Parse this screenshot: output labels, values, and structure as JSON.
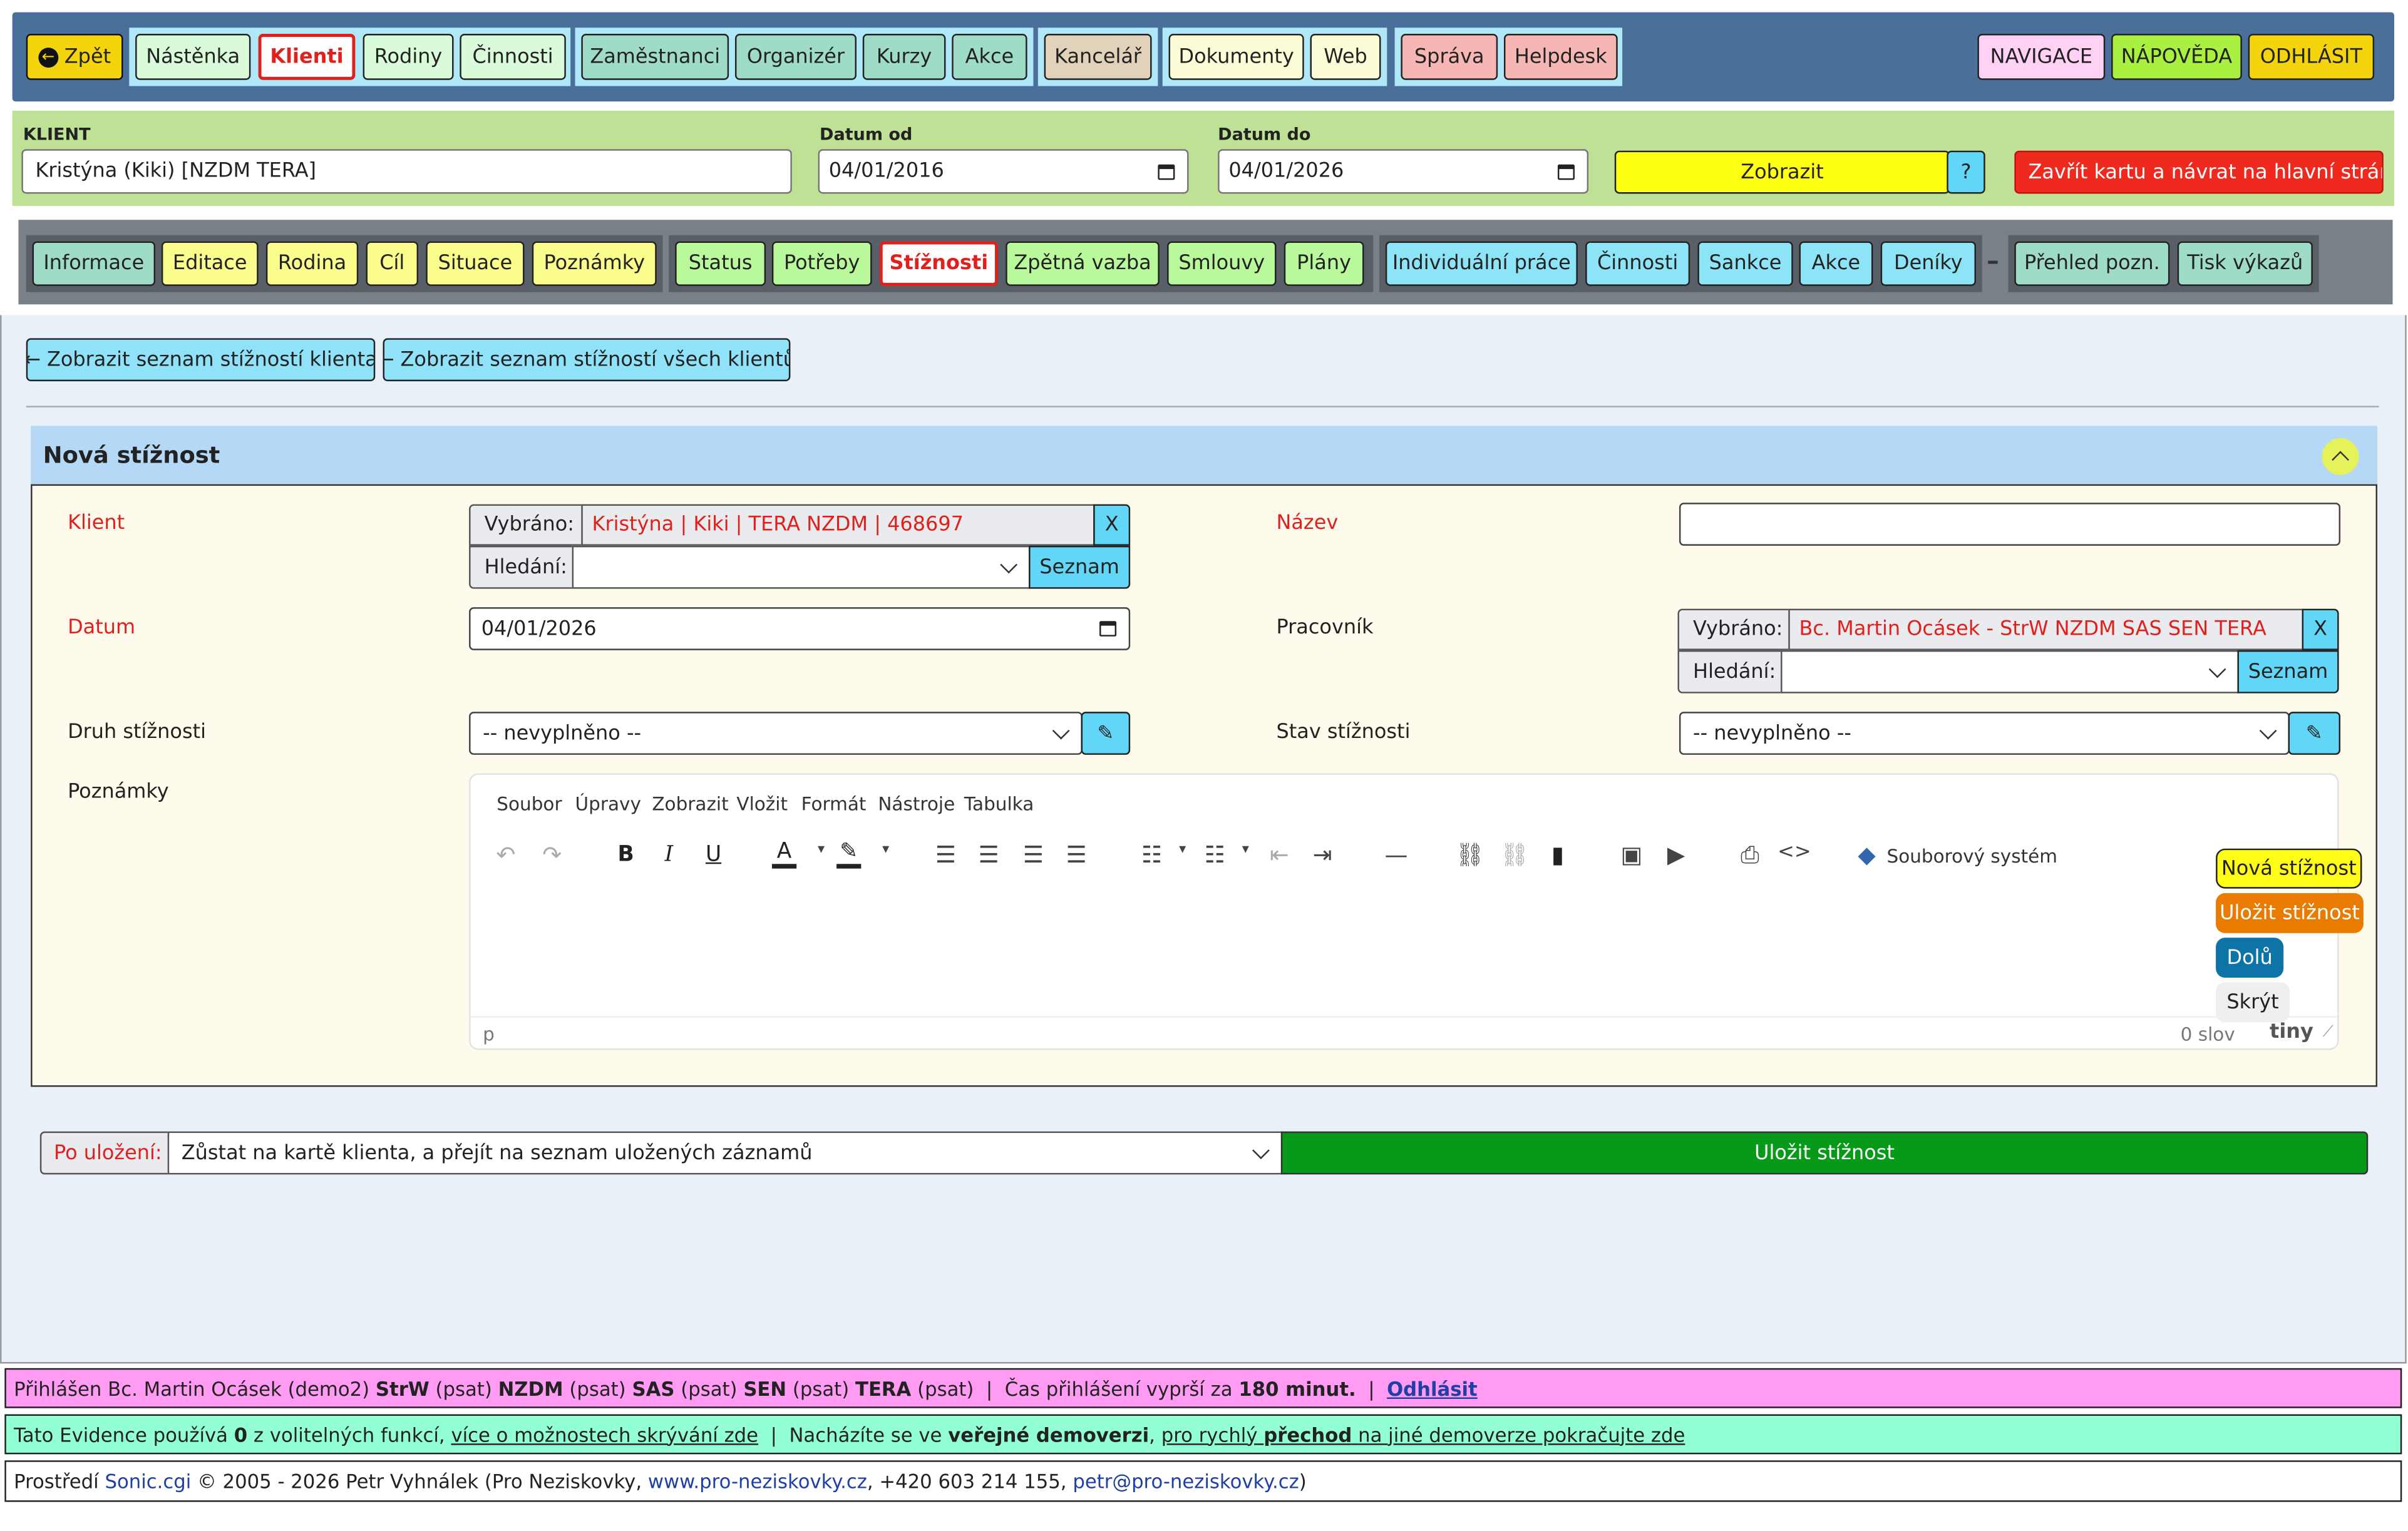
{
  "nav": {
    "back": "Zpět",
    "group1": [
      "Nástěnka",
      "Klienti",
      "Rodiny",
      "Činnosti"
    ],
    "group2": [
      "Zaměstnanci",
      "Organizér",
      "Kurzy",
      "Akce"
    ],
    "group3": [
      "Kancelář"
    ],
    "group4": [
      "Dokumenty",
      "Web"
    ],
    "group5": [
      "Správa",
      "Helpdesk"
    ],
    "right": [
      "NAVIGACE",
      "NÁPOVĚDA",
      "ODHLÁSIT"
    ]
  },
  "filter": {
    "client_label": "KLIENT",
    "client_value": "Kristýna (Kiki) [NZDM TERA]",
    "date_from_label": "Datum od",
    "date_from": "04/01/2016",
    "date_to_label": "Datum do",
    "date_to": "04/01/2026",
    "show_button": "Zobrazit",
    "help_button": "?",
    "close_button": "Zavřít kartu a návrat na hlavní stránku"
  },
  "tabs": {
    "group1": [
      "Informace",
      "Editace",
      "Rodina",
      "Cíl",
      "Situace",
      "Poznámky"
    ],
    "group2": [
      "Status",
      "Potřeby",
      "Stížnosti",
      "Zpětná vazba",
      "Smlouvy",
      "Plány"
    ],
    "group3": [
      "Individuální práce",
      "Činnosti",
      "Sankce",
      "Akce",
      "Deníky"
    ],
    "separator": "–",
    "group4": [
      "Přehled pozn.",
      "Tisk výkazů"
    ]
  },
  "list_buttons": {
    "client_list": "Zobrazit seznam stížností klienta",
    "all_list": "Zobrazit seznam stížností všech klientů"
  },
  "form": {
    "title": "Nová stížnost",
    "client_label": "Klient",
    "selected_label": "Vybráno:",
    "client_selected": "Kristýna | Kiki | TERA NZDM | 468697",
    "clear": "X",
    "search_label": "Hledání:",
    "list_button": "Seznam",
    "name_label": "Název",
    "date_label": "Datum",
    "date_value": "04/01/2026",
    "worker_label": "Pracovník",
    "worker_selected": "Bc. Martin Ocásek - StrW NZDM SAS SEN TERA",
    "type_label": "Druh stížnosti",
    "type_value": "-- nevyplněno --",
    "state_label": "Stav stížnosti",
    "state_value": "-- nevyplněno --",
    "notes_label": "Poznámky"
  },
  "editor": {
    "menu": [
      "Soubor",
      "Úpravy",
      "Zobrazit",
      "Vložit",
      "Formát",
      "Nástroje",
      "Tabulka"
    ],
    "filesystem": "Souborový systém",
    "path": "p",
    "wordcount": "0 slov",
    "brand": "tiny"
  },
  "float_buttons": [
    "Nová stížnost",
    "Uložit stížnost",
    "Dolů",
    "Skrýt"
  ],
  "after_save": {
    "label": "Po uložení:",
    "value": "Zůstat na kartě klienta, a přejít na seznam uložených záznamů",
    "save": "Uložit stížnost"
  },
  "footer": {
    "login_prefix": "Přihlášen Bc. Martin Ocásek (demo2)",
    "r1": "StrW",
    "p1": "(psat)",
    "r2": "NZDM",
    "p2": "(psat)",
    "r3": "SAS",
    "p3": "(psat)",
    "r4": "SEN",
    "p4": "(psat)",
    "r5": "TERA",
    "p5": "(psat)",
    "expire_text": "Čas přihlášení vyprší za",
    "expire_value": "180 minut.",
    "logout": "Odhlásit",
    "ev1": "Tato Evidence používá",
    "ev_count": "0",
    "ev2": "z volitelných funkcí,",
    "ev_link": "více o možnostech skrývání zde",
    "ev3": "Nacházíte se ve",
    "ev_demo": "veřejné demoverzi",
    "ev4": "pro rychlý",
    "ev_jump": "přechod",
    "ev5": "na jiné demoverze pokračujte zde",
    "copy1": "Prostředí",
    "copy_app": "Sonic.cgi",
    "copy2": "© 2005 - 2026 Petr Vyhnálek (Pro Neziskovky,",
    "copy_web": "www.pro-neziskovky.cz",
    "copy3": ", +420 603 214 155,",
    "copy_mail": "petr@pro-neziskovky.cz",
    "copy4": ")"
  },
  "colors": {
    "header_bg": "#4a6f9a",
    "filter_bg": "#bfe195",
    "tabs_bg": "#7a8088",
    "page_bg": "#e9f0f8",
    "form_bg": "#fffbec",
    "section_header": "#b5d8f6",
    "save_green": "#069a18",
    "footer_pink": "#ff9bf3",
    "footer_mint": "#93ffd5"
  }
}
